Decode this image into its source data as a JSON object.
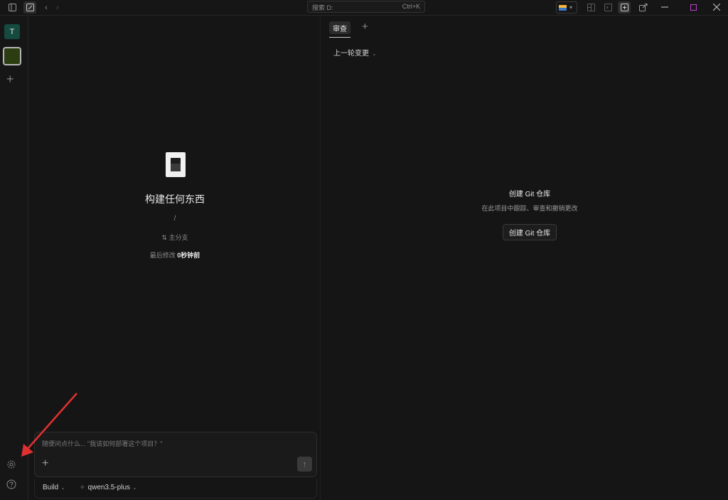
{
  "titlebar": {
    "search_placeholder": "搜索 D:",
    "search_shortcut": "Ctrl+K",
    "icons": [
      "sidebar-toggle-icon",
      "new-session-icon",
      "back-arrow-icon",
      "forward-arrow-icon"
    ],
    "window_controls": [
      "minimize",
      "maximize",
      "close"
    ]
  },
  "rail": {
    "workspace_initial": "T",
    "add_label": "+",
    "icons": [
      "gear-icon",
      "help-icon"
    ]
  },
  "main": {
    "title": "构建任何东西",
    "path": "/",
    "branch_label": "主分支",
    "modified_label": "最后修改",
    "modified_value": "0秒钟前",
    "composer": {
      "placeholder": "随便问点什么... \"我该如何部署这个项目？\"",
      "mode": "Build",
      "model": "qwen3.5-plus"
    }
  },
  "right": {
    "tab_label": "审查",
    "tab_add": "+",
    "changes_label": "上一轮变更",
    "git_title": "创建 Git 仓库",
    "git_subtitle": "在此项目中跟踪、审查和撤销更改",
    "git_button": "创建 Git 仓库"
  },
  "colors": {
    "background": "#151515",
    "accent_workspace": "#144a40",
    "project_avatar": "#2d3d12",
    "annotation_arrow": "#e03030"
  }
}
